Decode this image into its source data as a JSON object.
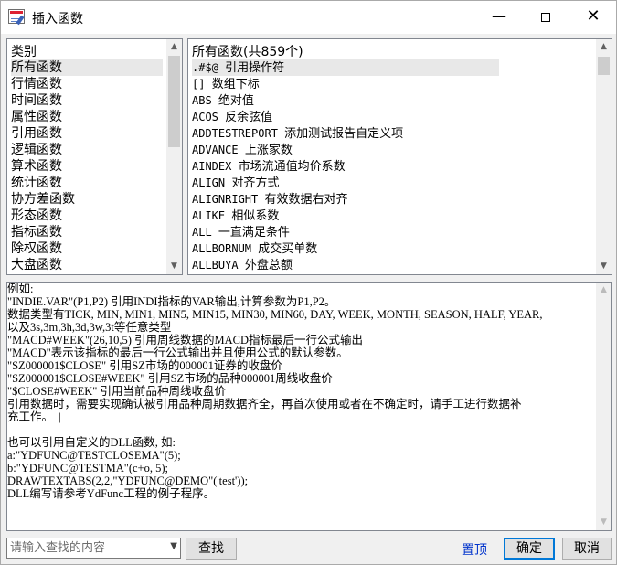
{
  "window": {
    "title": "插入函数",
    "min_glyph": "—",
    "close_glyph": "✕"
  },
  "categories": {
    "header": "类别",
    "items": [
      "所有函数",
      "行情函数",
      "时间函数",
      "属性函数",
      "引用函数",
      "逻辑函数",
      "算术函数",
      "统计函数",
      "协方差函数",
      "形态函数",
      "指标函数",
      "除权函数",
      "大盘函数"
    ],
    "selected_index": 0
  },
  "functions": {
    "header": "所有函数(共859个)",
    "items": [
      {
        "code": ".#$@",
        "name": "引用操作符"
      },
      {
        "code": "[]",
        "name": "数组下标"
      },
      {
        "code": "ABS",
        "name": "绝对值"
      },
      {
        "code": "ACOS",
        "name": "反余弦值"
      },
      {
        "code": "ADDTESTREPORT",
        "name": "添加测试报告自定义项"
      },
      {
        "code": "ADVANCE",
        "name": "上涨家数"
      },
      {
        "code": "AINDEX",
        "name": "市场流通值均价系数"
      },
      {
        "code": "ALIGN",
        "name": "对齐方式"
      },
      {
        "code": "ALIGNRIGHT",
        "name": "有效数据右对齐"
      },
      {
        "code": "ALIKE",
        "name": "相似系数"
      },
      {
        "code": "ALL",
        "name": "一直满足条件"
      },
      {
        "code": "ALLBORNUM",
        "name": "成交买单数"
      },
      {
        "code": "ALLBUYA",
        "name": "外盘总额"
      }
    ],
    "selected_index": 0
  },
  "scroll": {
    "up": "▲",
    "down": "▼"
  },
  "description": {
    "lines": [
      "例如:",
      "\"INDIE.VAR\"(P1,P2) 引用INDI指标的VAR输出,计算参数为P1,P2。",
      "数据类型有TICK, MIN, MIN1, MIN5, MIN15, MIN30, MIN60, DAY, WEEK, MONTH, SEASON, HALF, YEAR,",
      "以及3s,3m,3h,3d,3w,3t等任意类型",
      "\"MACD#WEEK\"(26,10,5) 引用周线数据的MACD指标最后一行公式输出",
      "\"MACD\"表示该指标的最后一行公式输出并且使用公式的默认参数。",
      "\"SZ000001$CLOSE\" 引用SZ市场的000001证券的收盘价",
      "\"SZ000001$CLOSE#WEEK\" 引用SZ市场的品种000001周线收盘价",
      "\"$CLOSE#WEEK\" 引用当前品种周线收盘价",
      "引用数据时，需要实现确认被引用品种周期数据齐全，再首次使用或者在不确定时，请手工进行数据补",
      "充工作。  |",
      "",
      "也可以引用自定义的DLL函数, 如:",
      "a:\"YDFUNC@TESTCLOSEMA\"(5);",
      "b:\"YDFUNC@TESTMA\"(c+o, 5);",
      "DRAWTEXTABS(2,2,\"YDFUNC@DEMO\"('test'));",
      "DLL编写请参考YdFunc工程的例子程序。"
    ]
  },
  "footer": {
    "search_placeholder": "请输入查找的内容",
    "search_value": "",
    "find_button": "查找",
    "top_link": "置顶",
    "ok_button": "确定",
    "cancel_button": "取消"
  },
  "colors": {
    "accent": "#0078d7",
    "link": "#0033cc"
  }
}
